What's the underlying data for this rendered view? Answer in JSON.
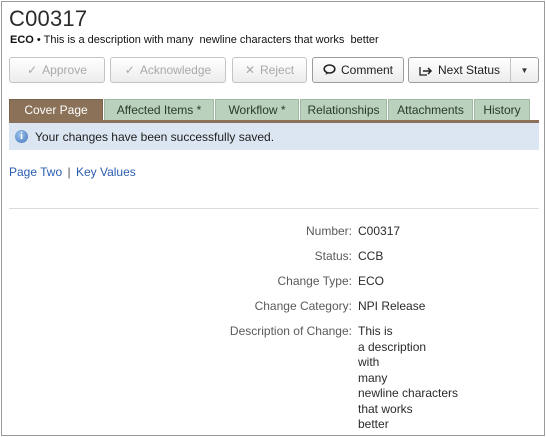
{
  "header": {
    "title": "C00317",
    "type_prefix": "ECO",
    "bullet": "•",
    "description": "This is a description with many  newline characters that works  better"
  },
  "toolbar": {
    "approve": "Approve",
    "acknowledge": "Acknowledge",
    "reject": "Reject",
    "comment": "Comment",
    "next_status": "Next Status"
  },
  "tabs": [
    {
      "label": "Cover Page",
      "active": true
    },
    {
      "label": "Affected Items *",
      "active": false
    },
    {
      "label": "Workflow *",
      "active": false
    },
    {
      "label": "Relationships",
      "active": false
    },
    {
      "label": "Attachments",
      "active": false
    },
    {
      "label": "History",
      "active": false
    }
  ],
  "banner": {
    "message": "Your changes have been successfully saved."
  },
  "links": {
    "page_two": "Page Two",
    "separator": "|",
    "key_values": "Key Values"
  },
  "fields": [
    {
      "label": "Number:",
      "value": "C00317"
    },
    {
      "label": "Status:",
      "value": "CCB"
    },
    {
      "label": "Change Type:",
      "value": "ECO"
    },
    {
      "label": "Change Category:",
      "value": "NPI Release"
    },
    {
      "label": "Description of Change:",
      "value_lines": [
        "This is",
        "a description",
        "with",
        "many",
        "newline characters",
        "that works",
        "better"
      ]
    }
  ],
  "colors": {
    "active_tab": "#8a7157",
    "inactive_tab": "#b9d1bd",
    "banner_bg": "#dce6f2",
    "link": "#2a5db0"
  }
}
